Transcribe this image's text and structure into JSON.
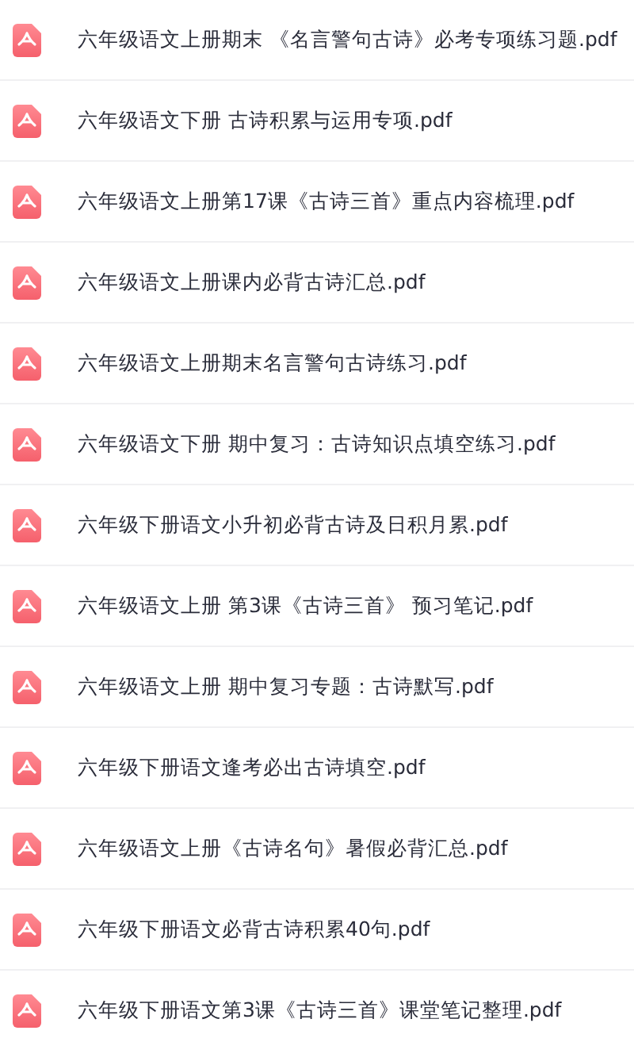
{
  "files": [
    {
      "name": "六年级语文上册期末 《名言警句古诗》必考专项练习题.pdf"
    },
    {
      "name": "六年级语文下册 古诗积累与运用专项.pdf"
    },
    {
      "name": "六年级语文上册第17课《古诗三首》重点内容梳理.pdf"
    },
    {
      "name": "六年级语文上册课内必背古诗汇总.pdf"
    },
    {
      "name": "六年级语文上册期末名言警句古诗练习.pdf"
    },
    {
      "name": "六年级语文下册 期中复习：古诗知识点填空练习.pdf"
    },
    {
      "name": "六年级下册语文小升初必背古诗及日积月累.pdf"
    },
    {
      "name": "六年级语文上册 第3课《古诗三首》 预习笔记.pdf"
    },
    {
      "name": "六年级语文上册 期中复习专题：古诗默写.pdf"
    },
    {
      "name": "六年级下册语文逢考必出古诗填空.pdf"
    },
    {
      "name": "六年级语文上册《古诗名句》暑假必背汇总.pdf"
    },
    {
      "name": "六年级下册语文必背古诗积累40句.pdf"
    },
    {
      "name": "六年级下册语文第3课《古诗三首》课堂笔记整理.pdf"
    }
  ]
}
